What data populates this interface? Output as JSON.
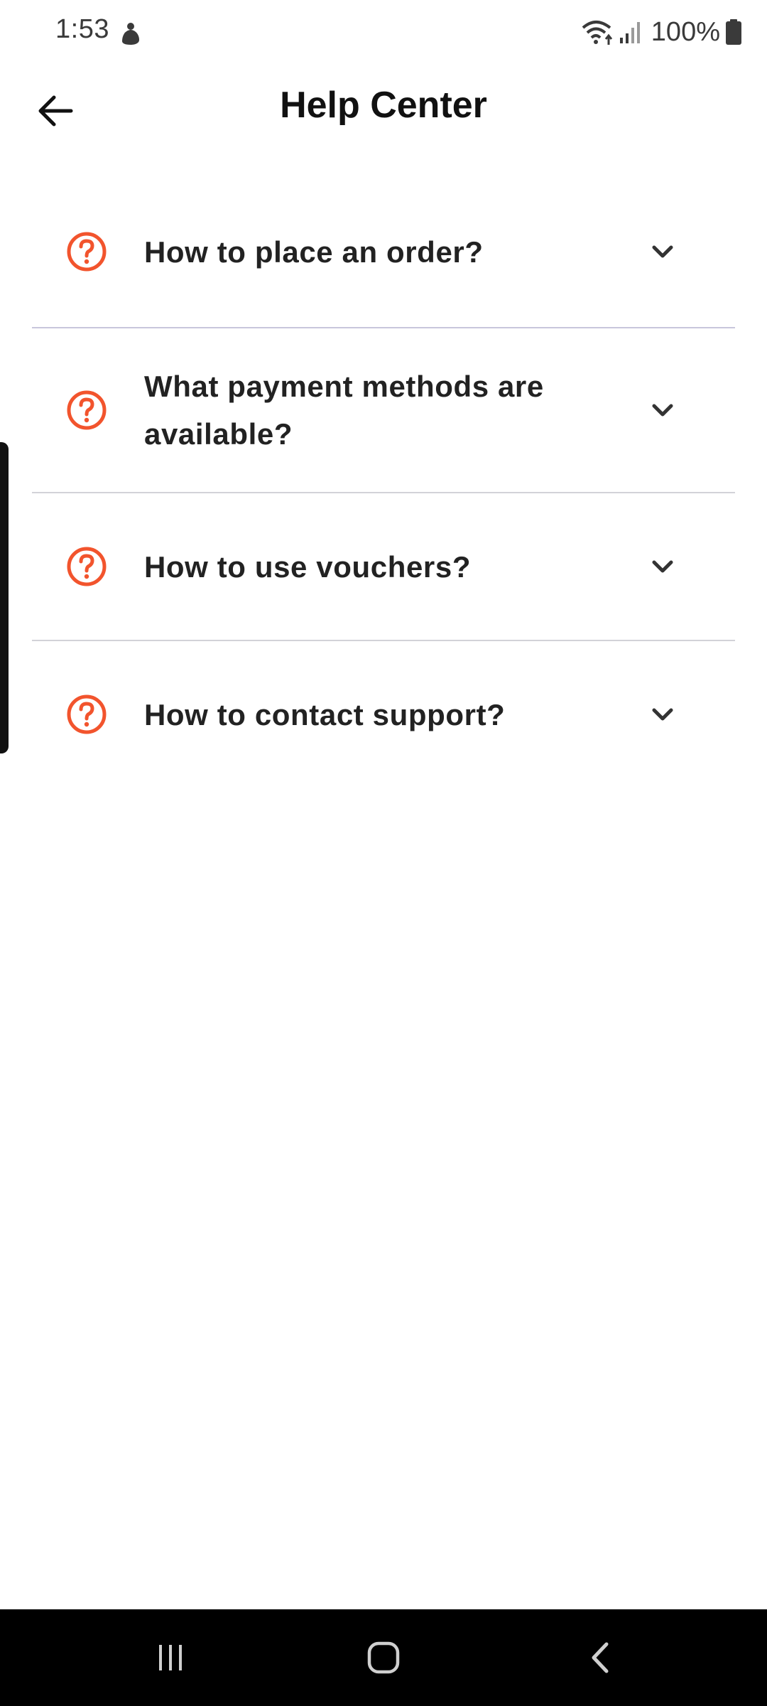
{
  "status_bar": {
    "time": "1:53",
    "battery": "100%",
    "icons": [
      "app-notification-icon",
      "wifi-icon",
      "signal-icon",
      "battery-icon"
    ]
  },
  "header": {
    "title": "Help Center",
    "back_icon": "arrow-left-icon"
  },
  "faq": {
    "items": [
      {
        "question": "How to place an order?"
      },
      {
        "question": "What payment methods are available?"
      },
      {
        "question": "How to use vouchers?"
      },
      {
        "question": "How to contact support?"
      }
    ],
    "icon": "question-circle-icon",
    "expand_icon": "chevron-down-icon"
  },
  "colors": {
    "accent": "#F2542D",
    "text": "#222222",
    "divider": "#D2D2D8",
    "nav_bar": "#000000"
  },
  "nav_bar": {
    "buttons": [
      "recent-apps-icon",
      "home-icon",
      "back-icon"
    ]
  }
}
